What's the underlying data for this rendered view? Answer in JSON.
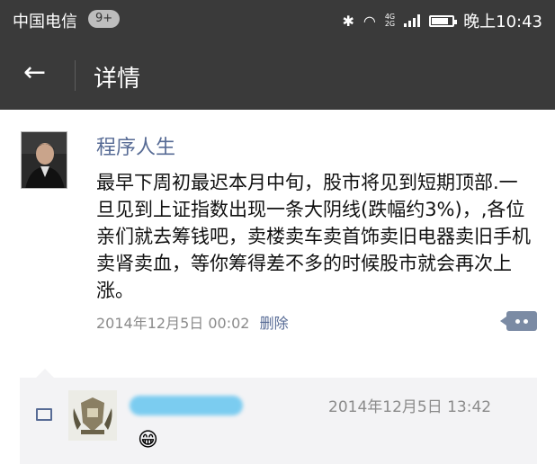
{
  "status_bar": {
    "carrier": "中国电信",
    "notification_count": "9+",
    "time": "晚上10:43",
    "icons": [
      "bluetooth-icon",
      "wifi-icon",
      "signal-icon",
      "battery-icon"
    ],
    "network_labels": [
      "4G",
      "2G"
    ]
  },
  "header": {
    "back_icon": "←",
    "title": "详情"
  },
  "post": {
    "author": "程序人生",
    "text": "最早下周初最迟本月中旬，股市将见到短期顶部.一旦见到上证指数出现一条大阴线(跌幅约3%)，,各位亲们就去筹钱吧，卖楼卖车卖首饰卖旧电器卖旧手机卖肾卖血，等你筹得差不多的时候股市就会再次上涨。",
    "timestamp": "2014年12月5日 00:02",
    "delete_label": "删除",
    "avatar_icon": "profile-photo"
  },
  "comment": {
    "comment_icon": "comment-icon",
    "avatar_icon": "crest-avatar",
    "timestamp": "2014年12月5日 13:42",
    "emoji": "😁"
  },
  "colors": {
    "bar_bg": "#3a3a3a",
    "link": "#576b95",
    "comment_bg": "#f3f3f5",
    "more_btn": "#7b8ba4"
  }
}
